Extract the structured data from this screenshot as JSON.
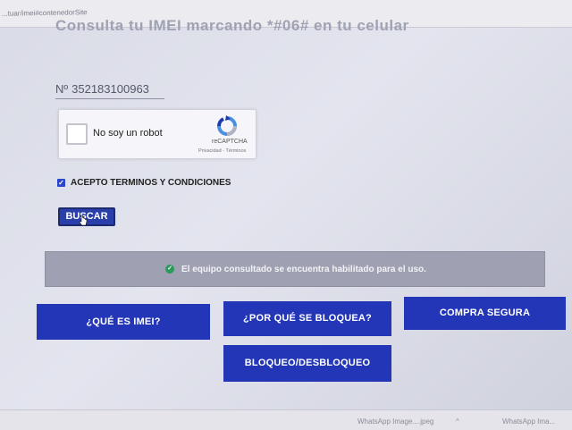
{
  "browser": {
    "url": "...tuar/imei#contenedorSite"
  },
  "page": {
    "heading_partial": "Consulta tu IMEI marcando *#06# en tu celular"
  },
  "form": {
    "imei_prefix": "Nº",
    "imei_value": "352183100963",
    "captcha": {
      "label": "No soy un robot",
      "brand": "reCAPTCHA",
      "links": "Privacidad - Términos"
    },
    "terms_label": "ACEPTO TERMINOS Y CONDICIONES",
    "terms_checked": true,
    "search_label": "BUSCAR"
  },
  "result": {
    "message": "El equipo consultado se encuentra habilitado para el uso.",
    "status_color": "#2a9a5c"
  },
  "nav_buttons": [
    {
      "label": "¿QUÉ ES IMEI?"
    },
    {
      "label": "¿POR QUÉ SE BLOQUEA?"
    },
    {
      "label": "COMPRA SEGURA"
    },
    {
      "label": "BLOQUEO/DESBLOQUEO"
    }
  ],
  "taskbar": {
    "item1": "WhatsApp Image....jpeg",
    "item2": "WhatsApp Ima..."
  },
  "colors": {
    "accent": "#2436b8",
    "alert_bg": "#9fa1b2"
  }
}
